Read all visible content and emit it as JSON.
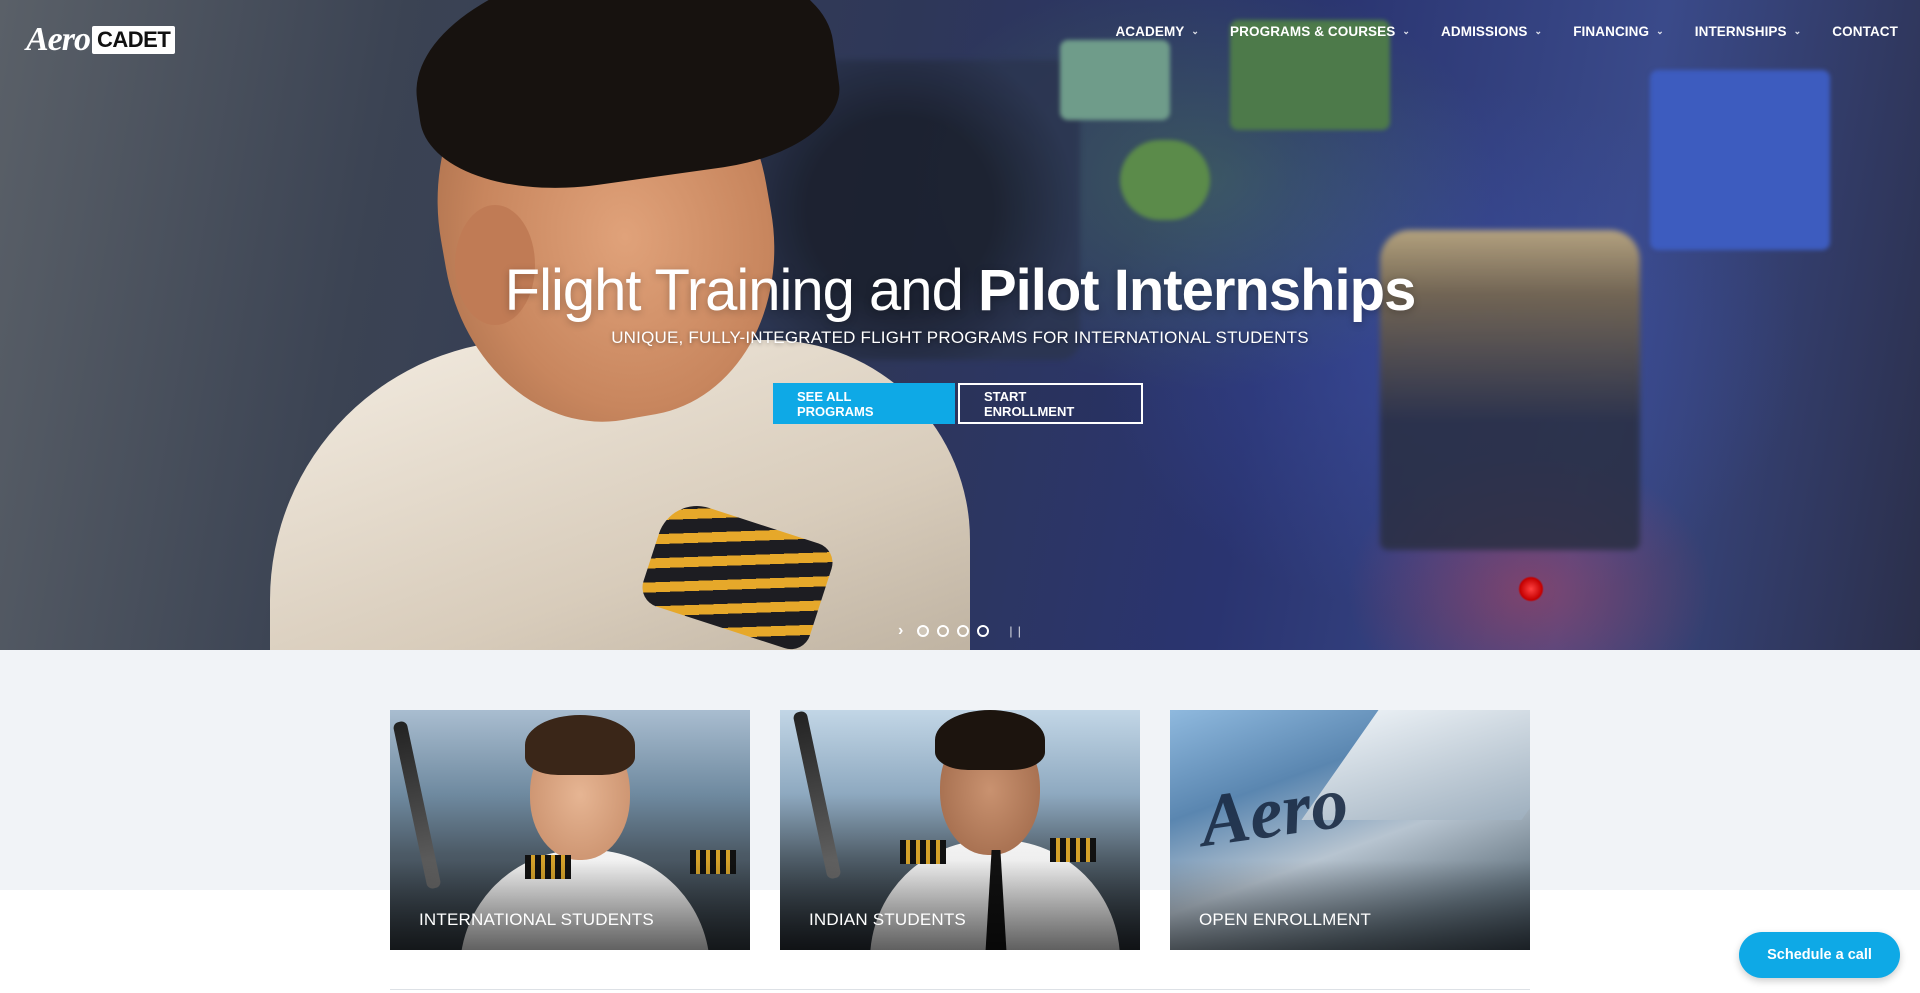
{
  "header": {
    "logo_aero": "Aero",
    "logo_cadet": "CADET",
    "nav": [
      {
        "label": "ACADEMY",
        "has_dropdown": true
      },
      {
        "label": "PROGRAMS & COURSES",
        "has_dropdown": true
      },
      {
        "label": "ADMISSIONS",
        "has_dropdown": true
      },
      {
        "label": "FINANCING",
        "has_dropdown": true
      },
      {
        "label": "INTERNSHIPS",
        "has_dropdown": true
      },
      {
        "label": "CONTACT",
        "has_dropdown": false
      }
    ]
  },
  "hero": {
    "title_light": "Flight Training and ",
    "title_bold": "Pilot Internships",
    "subtitle": "UNIQUE, FULLY-INTEGRATED FLIGHT PROGRAMS FOR INTERNATIONAL STUDENTS",
    "primary_button": "SEE ALL PROGRAMS",
    "secondary_button": "START ENROLLMENT",
    "slider": {
      "slide_count": 4,
      "active_index": 0,
      "next_icon": "chevron-right-icon",
      "pause_icon": "pause-icon"
    }
  },
  "cards": [
    {
      "label": "INTERNATIONAL STUDENTS"
    },
    {
      "label": "INDIAN STUDENTS"
    },
    {
      "label": "OPEN ENROLLMENT"
    }
  ],
  "cta": {
    "schedule_label": "Schedule a call"
  },
  "colors": {
    "accent": "#0ea9e6",
    "section_bg": "#f1f3f7",
    "white": "#ffffff"
  }
}
